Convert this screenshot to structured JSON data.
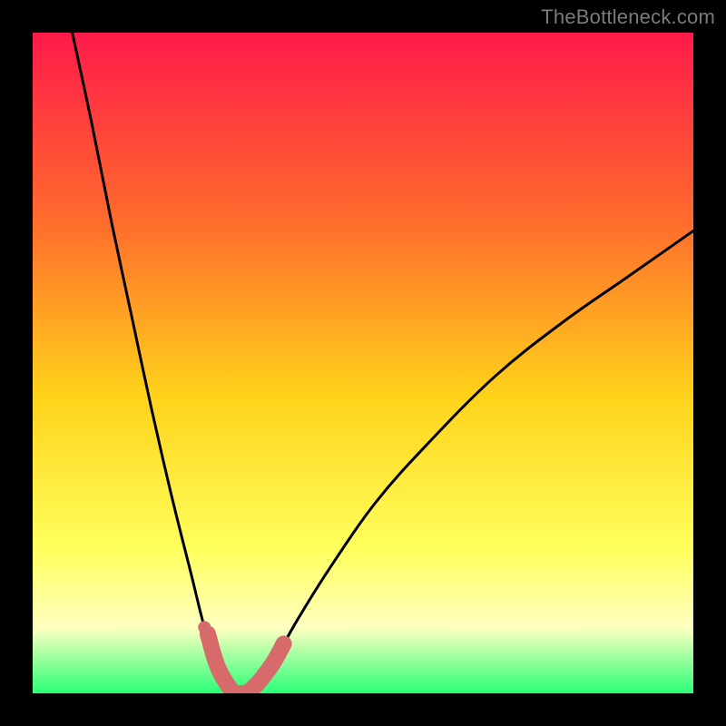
{
  "attribution": "TheBottleneck.com",
  "colors": {
    "frame": "#000000",
    "gradient_top": "#ff1a4a",
    "gradient_mid_upper": "#ff6a2d",
    "gradient_mid": "#ffd21a",
    "gradient_mid_lower": "#ffff5c",
    "gradient_pale": "#ffffc0",
    "gradient_bottom": "#2aff78",
    "curve": "#000000",
    "accent": "#d76b6c"
  },
  "chart_data": {
    "type": "line",
    "title": "",
    "xlabel": "",
    "ylabel": "",
    "xlim": [
      0,
      100
    ],
    "ylim": [
      0,
      100
    ],
    "grid": false,
    "legend": false,
    "vertex": {
      "x": 31,
      "y": 0
    },
    "series": [
      {
        "name": "bottleneck-curve",
        "points": [
          {
            "x": 6,
            "y": 100
          },
          {
            "x": 9,
            "y": 86
          },
          {
            "x": 12,
            "y": 71
          },
          {
            "x": 15,
            "y": 57
          },
          {
            "x": 18,
            "y": 43
          },
          {
            "x": 21,
            "y": 30
          },
          {
            "x": 24,
            "y": 18
          },
          {
            "x": 26,
            "y": 10
          },
          {
            "x": 28,
            "y": 4
          },
          {
            "x": 30,
            "y": 0.6
          },
          {
            "x": 31,
            "y": 0
          },
          {
            "x": 33,
            "y": 0.5
          },
          {
            "x": 36,
            "y": 4
          },
          {
            "x": 40,
            "y": 11
          },
          {
            "x": 45,
            "y": 19
          },
          {
            "x": 52,
            "y": 29
          },
          {
            "x": 60,
            "y": 38
          },
          {
            "x": 70,
            "y": 48
          },
          {
            "x": 80,
            "y": 56
          },
          {
            "x": 90,
            "y": 63
          },
          {
            "x": 100,
            "y": 70
          }
        ]
      },
      {
        "name": "highlight-band",
        "points": [
          {
            "x": 26.5,
            "y": 9
          },
          {
            "x": 28,
            "y": 4
          },
          {
            "x": 30,
            "y": 0.6
          },
          {
            "x": 31,
            "y": 0
          },
          {
            "x": 33,
            "y": 0.5
          },
          {
            "x": 36,
            "y": 4
          },
          {
            "x": 38,
            "y": 7.5
          }
        ]
      },
      {
        "name": "highlight-dot",
        "points": [
          {
            "x": 26,
            "y": 10
          }
        ]
      }
    ]
  }
}
